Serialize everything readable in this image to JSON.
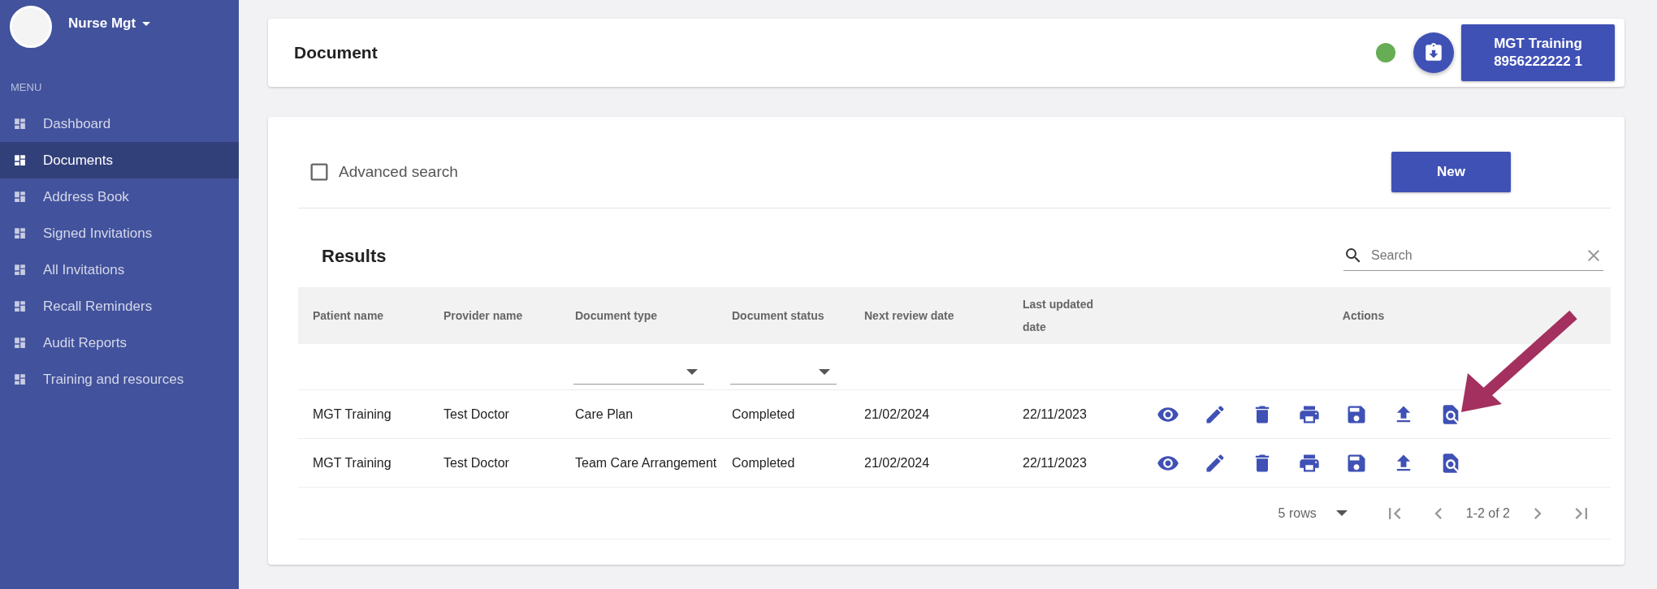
{
  "sidebar": {
    "brand": "Nurse Mgt",
    "menu_label": "MENU",
    "items": [
      {
        "label": "Dashboard",
        "selected": false
      },
      {
        "label": "Documents",
        "selected": true
      },
      {
        "label": "Address Book",
        "selected": false
      },
      {
        "label": "Signed Invitations",
        "selected": false
      },
      {
        "label": "All Invitations",
        "selected": false
      },
      {
        "label": "Recall Reminders",
        "selected": false
      },
      {
        "label": "Audit Reports",
        "selected": false
      },
      {
        "label": "Training and resources",
        "selected": false
      }
    ]
  },
  "header": {
    "title": "Document",
    "patient_button": [
      "MGT Training",
      "8956222222 1"
    ]
  },
  "toolbar": {
    "advanced_search": {
      "label": "Advanced search",
      "checked": false
    },
    "new_button": "New"
  },
  "results": {
    "title": "Results",
    "search": {
      "placeholder": "Search"
    },
    "table": {
      "columns": [
        {
          "label": "Patient name",
          "filter": false
        },
        {
          "label": "Provider name",
          "filter": false
        },
        {
          "label": "Document type",
          "filter": true
        },
        {
          "label": "Document status",
          "filter": true
        },
        {
          "label": "Next review date",
          "filter": false
        },
        {
          "label": "Last updated date",
          "filter": false
        },
        {
          "label": "Actions",
          "filter": false
        }
      ],
      "rows": [
        {
          "cells": [
            "MGT Training",
            "Test Doctor",
            "Care Plan",
            "Completed",
            "21/02/2024",
            "22/11/2023"
          ]
        },
        {
          "cells": [
            "MGT Training",
            "Test Doctor",
            "Team Care Arrangement",
            "Completed",
            "21/02/2024",
            "22/11/2023"
          ]
        }
      ]
    },
    "pagination": {
      "rows_per_page": "5 rows",
      "range": "1-2 of 2"
    }
  }
}
